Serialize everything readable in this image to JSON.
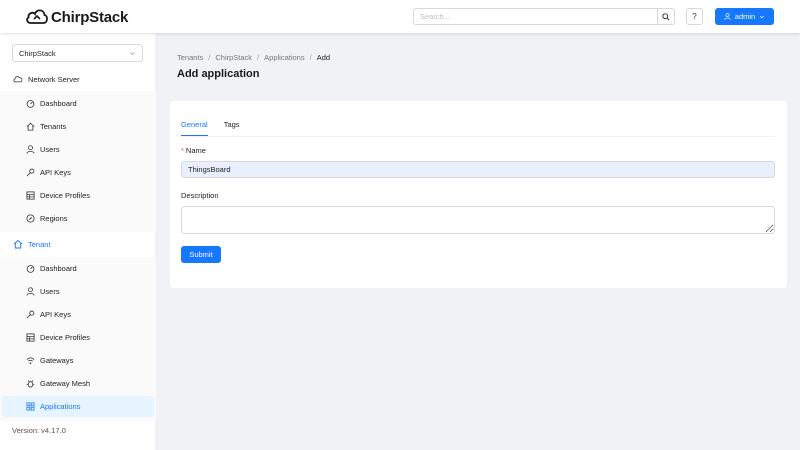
{
  "header": {
    "logo_text": "ChirpStack",
    "search_placeholder": "Search...",
    "help_label": "?",
    "user_label": "admin"
  },
  "sidebar": {
    "tenant_select_value": "ChirpStack",
    "network_server": {
      "label": "Network Server",
      "items": [
        {
          "label": "Dashboard",
          "icon": "dashboard-icon"
        },
        {
          "label": "Tenants",
          "icon": "home-icon"
        },
        {
          "label": "Users",
          "icon": "user-icon"
        },
        {
          "label": "API Keys",
          "icon": "key-icon"
        },
        {
          "label": "Device Profiles",
          "icon": "table-icon"
        },
        {
          "label": "Regions",
          "icon": "compass-icon"
        }
      ]
    },
    "tenant": {
      "label": "Tenant",
      "items": [
        {
          "label": "Dashboard",
          "icon": "dashboard-icon"
        },
        {
          "label": "Users",
          "icon": "user-icon"
        },
        {
          "label": "API Keys",
          "icon": "key-icon"
        },
        {
          "label": "Device Profiles",
          "icon": "table-icon"
        },
        {
          "label": "Gateways",
          "icon": "wifi-icon"
        },
        {
          "label": "Gateway Mesh",
          "icon": "bug-icon"
        },
        {
          "label": "Applications",
          "icon": "appstore-icon"
        }
      ],
      "selected": "Applications"
    },
    "version": "Version: v4.17.0"
  },
  "breadcrumb": [
    "Tenants",
    "ChirpStack",
    "Applications",
    "Add"
  ],
  "page_title": "Add application",
  "form": {
    "tabs": [
      {
        "label": "General",
        "active": true
      },
      {
        "label": "Tags",
        "active": false
      }
    ],
    "name_label": "Name",
    "name_required_mark": "*",
    "name_value": "ThingsBoard",
    "description_label": "Description",
    "description_value": "",
    "submit_label": "Submit"
  },
  "colors": {
    "primary": "#1677ff",
    "selected_bg": "#e6f4ff",
    "page_bg": "#f0f2f5"
  }
}
